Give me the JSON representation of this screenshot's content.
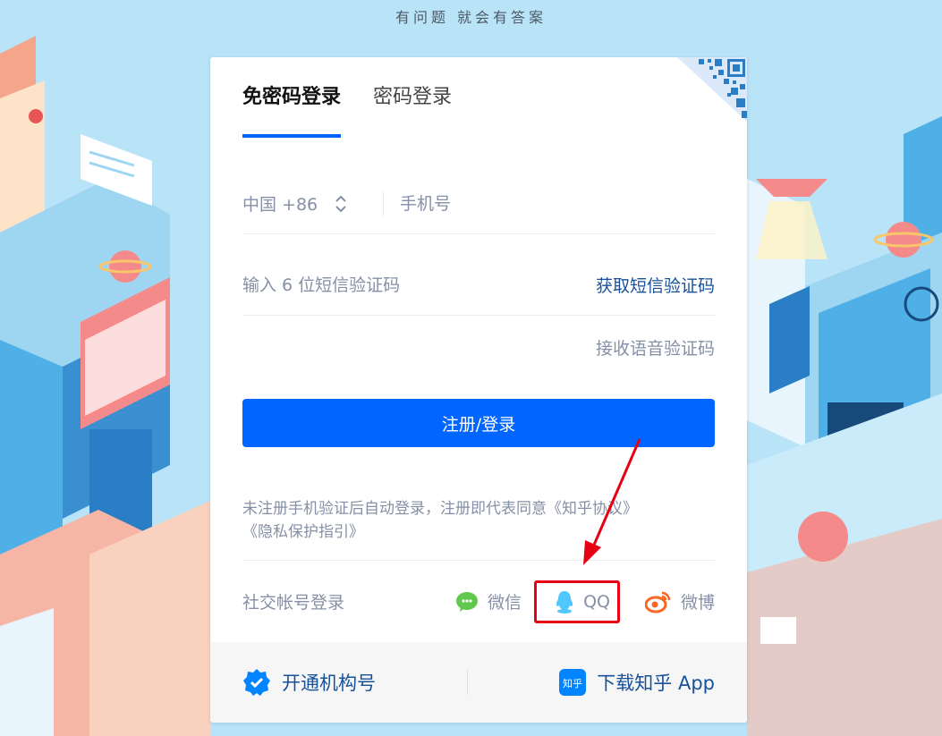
{
  "slogan": "有问题 就会有答案",
  "tabs": [
    {
      "label": "免密码登录",
      "active": true
    },
    {
      "label": "密码登录",
      "active": false
    }
  ],
  "phone": {
    "country_code": "中国 +86",
    "placeholder": "手机号"
  },
  "sms": {
    "placeholder": "输入 6 位短信验证码",
    "get_code_label": "获取短信验证码",
    "voice_code_label": "接收语音验证码"
  },
  "submit_label": "注册/登录",
  "agreement": {
    "prefix": "未注册手机验证后自动登录，注册即代表同意",
    "terms_link": "《知乎协议》",
    "privacy_link": "《隐私保护指引》"
  },
  "social": {
    "title": "社交帐号登录",
    "items": [
      {
        "label": "微信",
        "icon": "wechat-icon",
        "color": "#60c84d"
      },
      {
        "label": "QQ",
        "icon": "qq-icon",
        "color": "#50c8fd"
      },
      {
        "label": "微博",
        "icon": "weibo-icon",
        "color": "#fb6622"
      }
    ]
  },
  "footer": {
    "org_label": "开通机构号",
    "app_label": "下载知乎 App",
    "app_badge": "知乎"
  },
  "colors": {
    "primary": "#0066ff",
    "link": "#175199",
    "muted": "#8590a6",
    "highlight": "#e60012",
    "background": "#b9e3f7"
  }
}
